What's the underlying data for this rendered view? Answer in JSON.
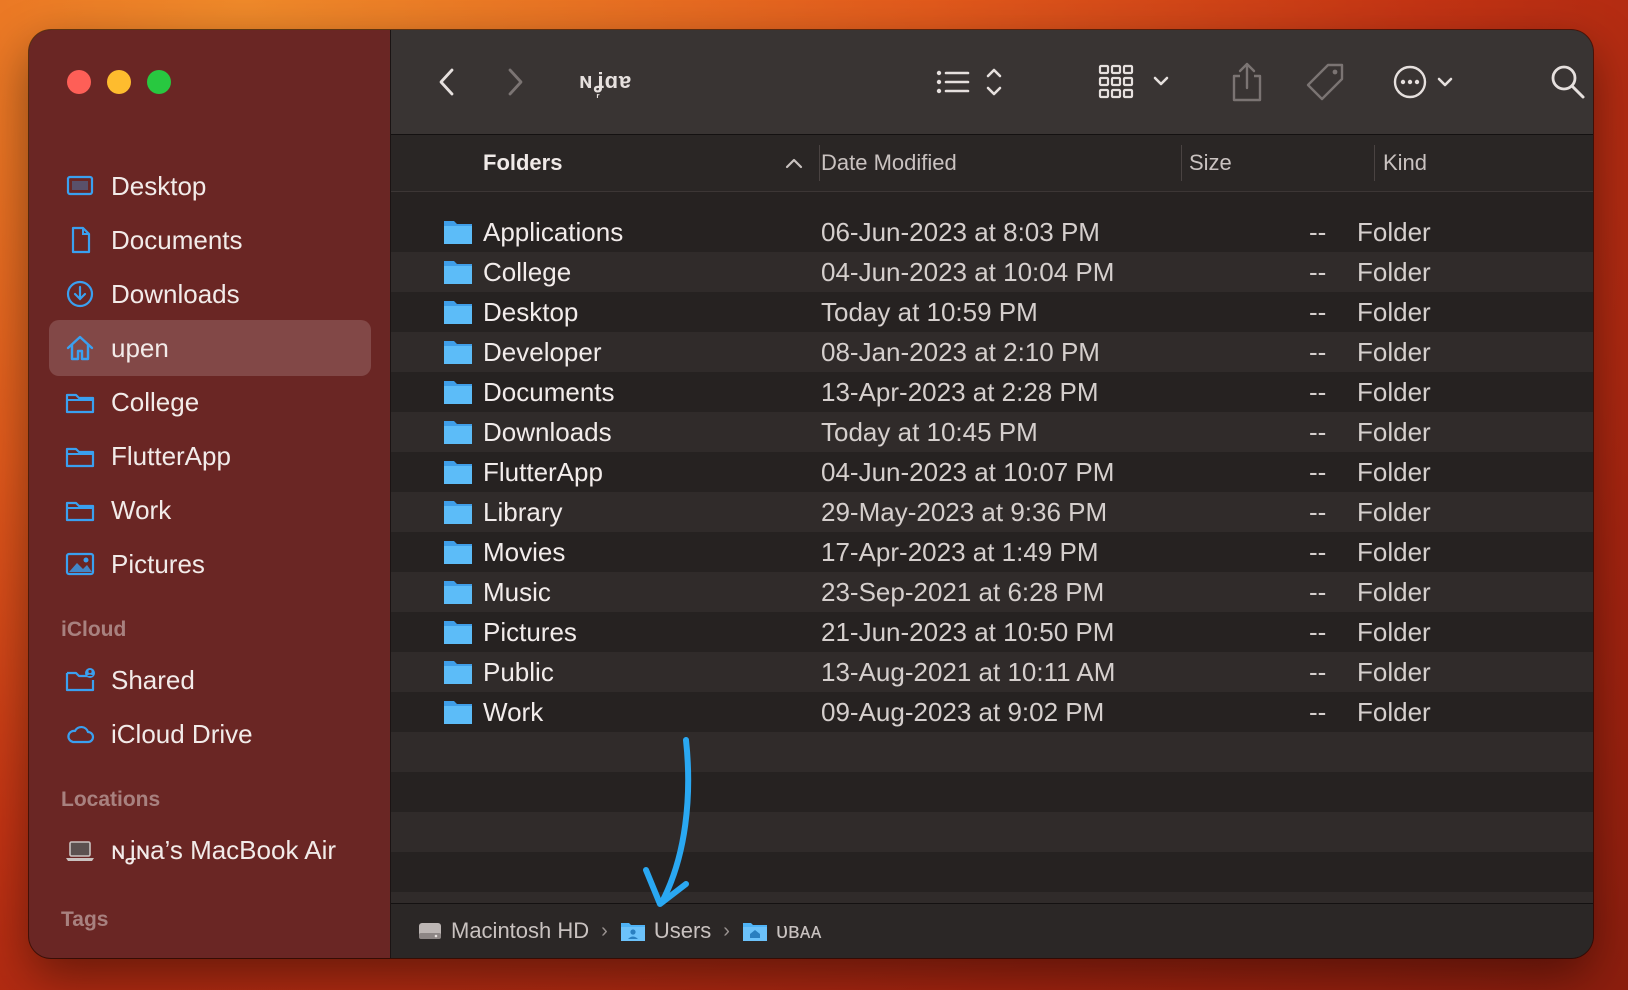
{
  "window": {
    "title": "ɴʝ᷊ɑɐ"
  },
  "sidebar": {
    "favorites": [
      {
        "label": "Desktop",
        "icon": "desktop-icon"
      },
      {
        "label": "Documents",
        "icon": "document-icon"
      },
      {
        "label": "Downloads",
        "icon": "download-icon"
      },
      {
        "label": "upen",
        "icon": "home-icon",
        "selected": true
      },
      {
        "label": "College",
        "icon": "folder-icon"
      },
      {
        "label": "FlutterApp",
        "icon": "folder-icon"
      },
      {
        "label": "Work",
        "icon": "folder-icon"
      },
      {
        "label": "Pictures",
        "icon": "pictures-icon"
      }
    ],
    "icloud_header": "iCloud",
    "icloud": [
      {
        "label": "Shared",
        "icon": "shared-folder-icon"
      },
      {
        "label": "iCloud Drive",
        "icon": "cloud-icon"
      }
    ],
    "locations_header": "Locations",
    "locations": [
      {
        "label": "ɴʝɴa’s MacBook Air",
        "icon": "laptop-icon"
      }
    ],
    "tags_header": "Tags"
  },
  "columns": {
    "name": "Folders",
    "date": "Date Modified",
    "size": "Size",
    "kind": "Kind"
  },
  "files": [
    {
      "name": "Applications",
      "date": "06-Jun-2023 at 8:03 PM",
      "size": "--",
      "kind": "Folder"
    },
    {
      "name": "College",
      "date": "04-Jun-2023 at 10:04 PM",
      "size": "--",
      "kind": "Folder"
    },
    {
      "name": "Desktop",
      "date": "Today at 10:59 PM",
      "size": "--",
      "kind": "Folder"
    },
    {
      "name": "Developer",
      "date": "08-Jan-2023 at 2:10 PM",
      "size": "--",
      "kind": "Folder"
    },
    {
      "name": "Documents",
      "date": "13-Apr-2023 at 2:28 PM",
      "size": "--",
      "kind": "Folder"
    },
    {
      "name": "Downloads",
      "date": "Today at 10:45 PM",
      "size": "--",
      "kind": "Folder"
    },
    {
      "name": "FlutterApp",
      "date": "04-Jun-2023 at 10:07 PM",
      "size": "--",
      "kind": "Folder"
    },
    {
      "name": "Library",
      "date": "29-May-2023 at 9:36 PM",
      "size": "--",
      "kind": "Folder"
    },
    {
      "name": "Movies",
      "date": "17-Apr-2023 at 1:49 PM",
      "size": "--",
      "kind": "Folder"
    },
    {
      "name": "Music",
      "date": "23-Sep-2021 at 6:28 PM",
      "size": "--",
      "kind": "Folder"
    },
    {
      "name": "Pictures",
      "date": "21-Jun-2023 at 10:50 PM",
      "size": "--",
      "kind": "Folder"
    },
    {
      "name": "Public",
      "date": "13-Aug-2021 at 10:11 AM",
      "size": "--",
      "kind": "Folder"
    },
    {
      "name": "Work",
      "date": "09-Aug-2023 at 9:02 PM",
      "size": "--",
      "kind": "Folder"
    }
  ],
  "pathbar": {
    "segments": [
      {
        "label": "Macintosh HD",
        "icon": "hard-drive-icon"
      },
      {
        "label": "Users",
        "icon": "users-folder-icon"
      },
      {
        "label": "ᴜʙᴀᴀ",
        "icon": "home-folder-icon"
      }
    ],
    "separator": "›"
  },
  "colors": {
    "sidebar_bg": "#6a2624",
    "accent_blue": "#3aa0f0",
    "folder_blue": "#4fb3f6",
    "annotation_arrow": "#2aa8f2"
  }
}
